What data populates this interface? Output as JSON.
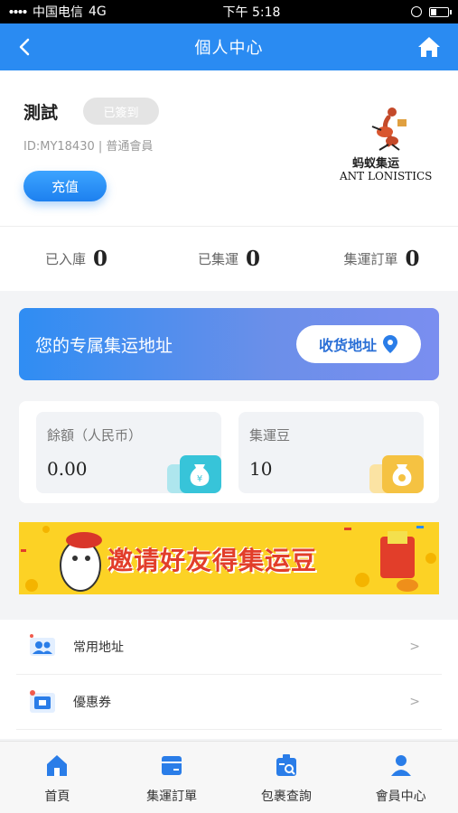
{
  "status_bar": {
    "carrier": "中国电信",
    "network": "4G",
    "time": "下午 5:18"
  },
  "nav": {
    "title": "個人中心"
  },
  "profile": {
    "name": "測試",
    "sign_badge": "已簽到",
    "meta": "ID:MY18430 | 普通會員",
    "recharge_label": "充值",
    "logo_cn": "蚂蚁集运",
    "logo_en": "ANT LONISTICS"
  },
  "stats": [
    {
      "label": "已入庫",
      "value": "0"
    },
    {
      "label": "已集運",
      "value": "0"
    },
    {
      "label": "集運訂單",
      "value": "0"
    }
  ],
  "address_banner": {
    "text": "您的专属集运地址",
    "button_label": "收货地址"
  },
  "balances": [
    {
      "label": "餘額（人民币）",
      "value": "0.00",
      "icon": "money-bag-icon",
      "color": "#37c4d9"
    },
    {
      "label": "集運豆",
      "value": "10",
      "icon": "coin-bag-icon",
      "color": "#f5c242"
    }
  ],
  "promo": {
    "text": "邀请好友得集运豆"
  },
  "menu": [
    {
      "label": "常用地址",
      "arrow": ">",
      "icon": "address-book-icon"
    },
    {
      "label": "優惠券",
      "arrow": ">",
      "icon": "coupon-icon"
    }
  ],
  "tabs": [
    {
      "label": "首頁",
      "icon": "home-icon"
    },
    {
      "label": "集運訂單",
      "icon": "order-icon"
    },
    {
      "label": "包裹查詢",
      "icon": "package-search-icon"
    },
    {
      "label": "會員中心",
      "icon": "member-icon"
    }
  ],
  "colors": {
    "primary": "#2a8bf2",
    "promo_bg": "#fcd225",
    "promo_text": "#e23e2a"
  }
}
